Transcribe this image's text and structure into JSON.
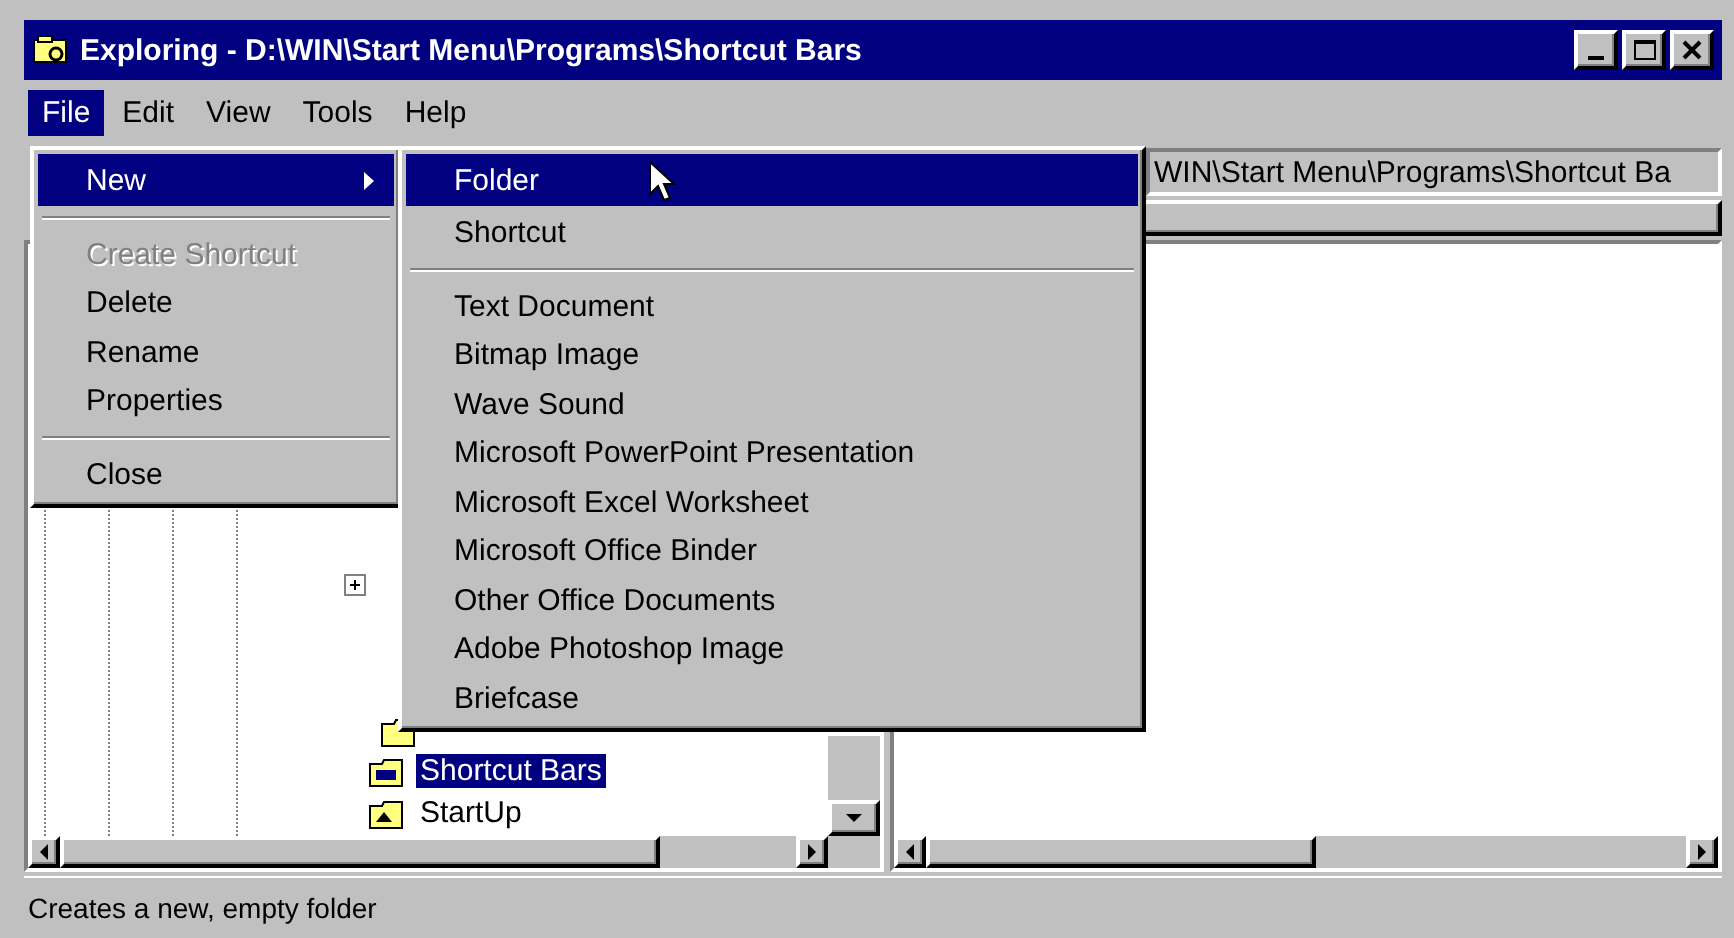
{
  "window": {
    "title": "Exploring - D:\\WIN\\Start Menu\\Programs\\Shortcut Bars"
  },
  "menu_bar": [
    {
      "label": "File",
      "selected": true
    },
    {
      "label": "Edit",
      "selected": false
    },
    {
      "label": "View",
      "selected": false
    },
    {
      "label": "Tools",
      "selected": false
    },
    {
      "label": "Help",
      "selected": false
    }
  ],
  "file_menu": [
    {
      "kind": "item",
      "label": "New",
      "submenu": true,
      "selected": true,
      "disabled": false
    },
    {
      "kind": "separator"
    },
    {
      "kind": "item",
      "label": "Create Shortcut",
      "submenu": false,
      "selected": false,
      "disabled": true
    },
    {
      "kind": "item",
      "label": "Delete",
      "submenu": false,
      "selected": false,
      "disabled": false
    },
    {
      "kind": "item",
      "label": "Rename",
      "submenu": false,
      "selected": false,
      "disabled": false
    },
    {
      "kind": "item",
      "label": "Properties",
      "submenu": false,
      "selected": false,
      "disabled": false
    },
    {
      "kind": "separator"
    },
    {
      "kind": "item",
      "label": "Close",
      "submenu": false,
      "selected": false,
      "disabled": false
    }
  ],
  "new_submenu": [
    {
      "kind": "item",
      "label": "Folder",
      "selected": true
    },
    {
      "kind": "item",
      "label": "Shortcut",
      "selected": false
    },
    {
      "kind": "separator"
    },
    {
      "kind": "item",
      "label": "Text Document",
      "selected": false
    },
    {
      "kind": "item",
      "label": "Bitmap Image",
      "selected": false
    },
    {
      "kind": "item",
      "label": "Wave Sound",
      "selected": false
    },
    {
      "kind": "item",
      "label": "Microsoft PowerPoint Presentation",
      "selected": false
    },
    {
      "kind": "item",
      "label": "Microsoft Excel Worksheet",
      "selected": false
    },
    {
      "kind": "item",
      "label": "Microsoft Office Binder",
      "selected": false
    },
    {
      "kind": "item",
      "label": "Other Office Documents",
      "selected": false
    },
    {
      "kind": "item",
      "label": "Adobe Photoshop Image",
      "selected": false
    },
    {
      "kind": "item",
      "label": "Briefcase",
      "selected": false
    }
  ],
  "address": "WIN\\Start Menu\\Programs\\Shortcut Ba",
  "tree": {
    "items": [
      {
        "label": "Shortcut Bars",
        "selected": true
      },
      {
        "label": "StartUp",
        "selected": false
      }
    ]
  },
  "status_bar": "Creates a new, empty folder"
}
